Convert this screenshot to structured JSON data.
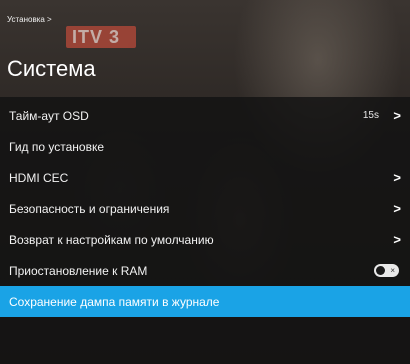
{
  "header": {
    "breadcrumb": "Установка >",
    "title": "Система"
  },
  "background": {
    "logo_text": "ITV 3"
  },
  "menu": {
    "items": [
      {
        "label": "Тайм-аут OSD",
        "value": "15s",
        "chevron": ">"
      },
      {
        "label": "Гид по установке"
      },
      {
        "label": "HDMI CEC",
        "chevron": ">"
      },
      {
        "label": "Безопасность и ограничения",
        "chevron": ">"
      },
      {
        "label": "Возврат к настройкам по умолчанию",
        "chevron": ">"
      },
      {
        "label": "Приостановление к RAM",
        "toggle": "off",
        "toggle_glyph": "×"
      },
      {
        "label": "Сохранение дампа памяти в журнале",
        "selected": true
      }
    ]
  },
  "colors": {
    "selected_row": "#1aa3e6",
    "menu_background": "#121212"
  }
}
